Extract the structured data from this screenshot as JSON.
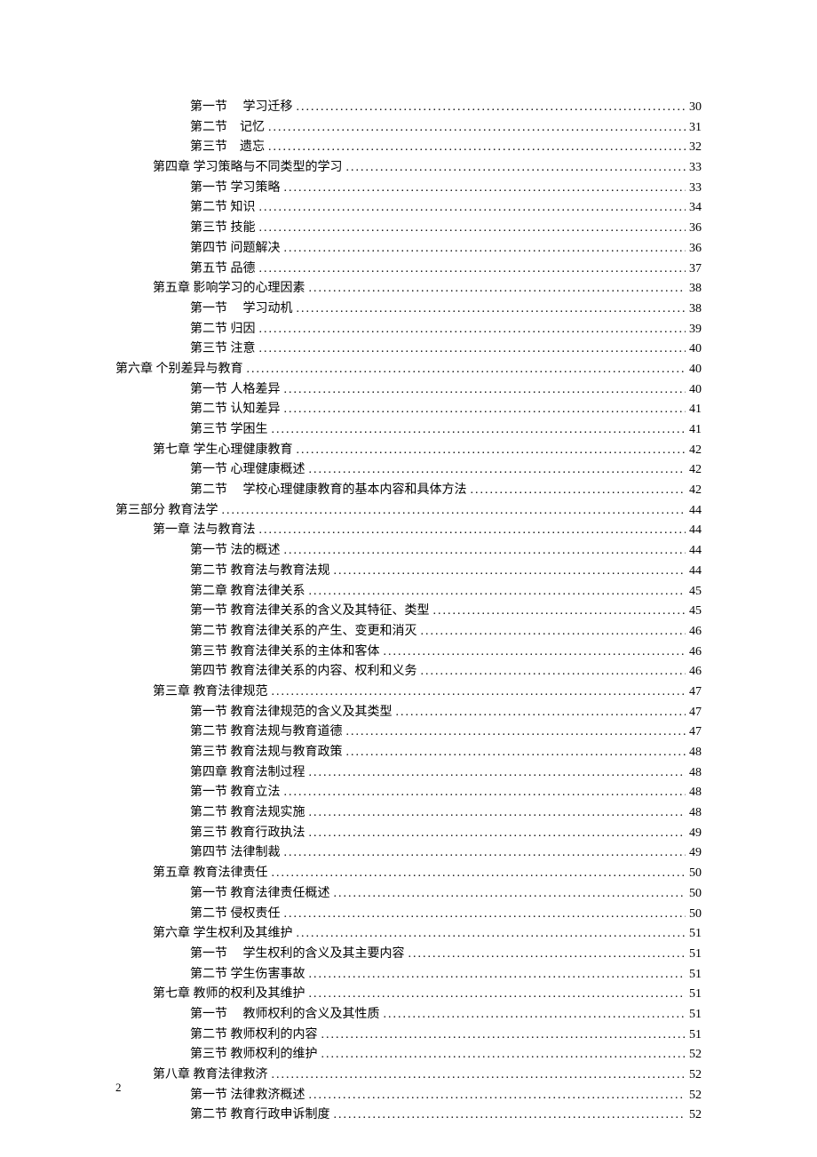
{
  "page_number": "2",
  "toc": [
    {
      "level": 2,
      "title": "第一节 　学习迁移",
      "page": "30"
    },
    {
      "level": 2,
      "title": "第二节　记忆",
      "page": "31"
    },
    {
      "level": 2,
      "title": "第三节　遗忘",
      "page": "32"
    },
    {
      "level": 1,
      "title": "第四章 学习策略与不同类型的学习",
      "page": "33"
    },
    {
      "level": 2,
      "title": "第一节  学习策略",
      "page": "33"
    },
    {
      "level": 2,
      "title": "第二节  知识",
      "page": "34"
    },
    {
      "level": 2,
      "title": "第三节  技能",
      "page": "36"
    },
    {
      "level": 2,
      "title": "第四节  问题解决",
      "page": "36"
    },
    {
      "level": 2,
      "title": "第五节  品德",
      "page": "37"
    },
    {
      "level": 1,
      "title": "第五章 影响学习的心理因素",
      "page": "38"
    },
    {
      "level": 2,
      "title": "第一节 　学习动机",
      "page": "38"
    },
    {
      "level": 2,
      "title": "第二节  归因",
      "page": "39"
    },
    {
      "level": 2,
      "title": "第三节  注意",
      "page": "40"
    },
    {
      "level": 0,
      "title": "第六章   个别差异与教育",
      "page": "40"
    },
    {
      "level": 2,
      "title": "第一节   人格差异",
      "page": "40"
    },
    {
      "level": 2,
      "title": "第二节  认知差异",
      "page": "41"
    },
    {
      "level": 2,
      "title": "第三节  学困生",
      "page": "41"
    },
    {
      "level": 1,
      "title": "第七章  学生心理健康教育",
      "page": "42"
    },
    {
      "level": 2,
      "title": "第一节  心理健康概述",
      "page": "42"
    },
    {
      "level": 2,
      "title": "第二节 　学校心理健康教育的基本内容和具体方法",
      "page": "42"
    },
    {
      "level": 0,
      "title": "第三部分   教育法学",
      "page": "44"
    },
    {
      "level": 1,
      "title": "第一章 法与教育法",
      "page": "44"
    },
    {
      "level": 2,
      "title": "第一节  法的概述",
      "page": "44"
    },
    {
      "level": 2,
      "title": "第二节  教育法与教育法规",
      "page": "44"
    },
    {
      "level": 2,
      "title": "第二章  教育法律关系",
      "page": "45"
    },
    {
      "level": 2,
      "title": "第一节  教育法律关系的含义及其特征、类型",
      "page": "45"
    },
    {
      "level": 2,
      "title": "第二节  教育法律关系的产生、变更和消灭",
      "page": "46"
    },
    {
      "level": 2,
      "title": "第三节  教育法律关系的主体和客体",
      "page": "46"
    },
    {
      "level": 2,
      "title": "第四节  教育法律关系的内容、权利和义务",
      "page": "46"
    },
    {
      "level": 1,
      "title": "第三章  教育法律规范",
      "page": "47"
    },
    {
      "level": 2,
      "title": "第一节  教育法律规范的含义及其类型",
      "page": "47"
    },
    {
      "level": 2,
      "title": "第二节  教育法规与教育道德",
      "page": "47"
    },
    {
      "level": 2,
      "title": "第三节  教育法规与教育政策",
      "page": "48"
    },
    {
      "level": 2,
      "title": "第四章  教育法制过程",
      "page": "48"
    },
    {
      "level": 2,
      "title": "第一节  教育立法",
      "page": "48"
    },
    {
      "level": 2,
      "title": "第二节  教育法规实施",
      "page": "48"
    },
    {
      "level": 2,
      "title": "第三节  教育行政执法",
      "page": "49"
    },
    {
      "level": 2,
      "title": "第四节  法律制裁",
      "page": "49"
    },
    {
      "level": 1,
      "title": "第五章  教育法律责任",
      "page": "50"
    },
    {
      "level": 2,
      "title": "第一节  教育法律责任概述",
      "page": "50"
    },
    {
      "level": 2,
      "title": "第二节  侵权责任",
      "page": "50"
    },
    {
      "level": 1,
      "title": "第六章  学生权利及其维护",
      "page": "51"
    },
    {
      "level": 2,
      "title": "第一节 　学生权利的含义及其主要内容",
      "page": "51"
    },
    {
      "level": 2,
      "title": "第二节  学生伤害事故",
      "page": "51"
    },
    {
      "level": 1,
      "title": "第七章  教师的权利及其维护",
      "page": "51"
    },
    {
      "level": 2,
      "title": "第一节 　教师权利的含义及其性质",
      "page": "51"
    },
    {
      "level": 2,
      "title": "第二节  教师权利的内容",
      "page": "51"
    },
    {
      "level": 2,
      "title": "第三节  教师权利的维护",
      "page": "52"
    },
    {
      "level": 1,
      "title": "第八章  教育法律救济",
      "page": "52"
    },
    {
      "level": 2,
      "title": "第一节  法律救济概述",
      "page": "52"
    },
    {
      "level": 2,
      "title": "第二节  教育行政申诉制度",
      "page": "52"
    }
  ]
}
